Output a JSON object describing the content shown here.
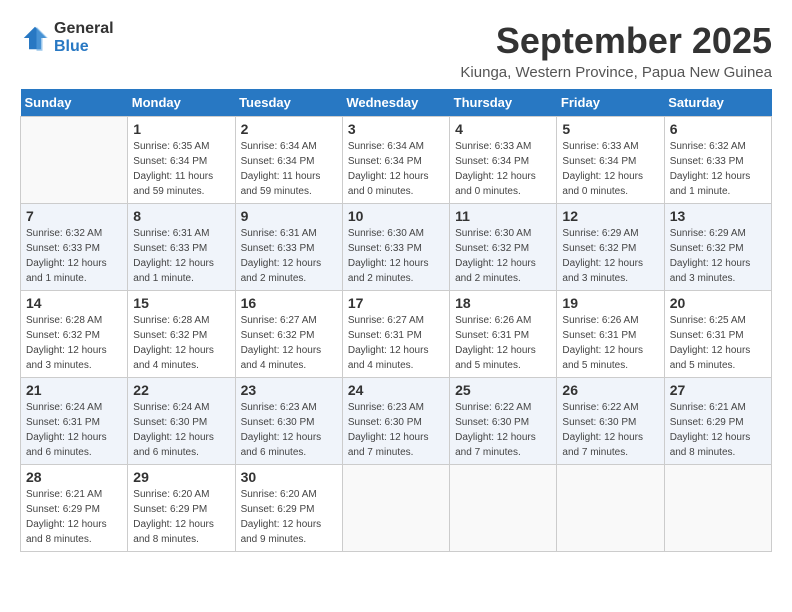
{
  "header": {
    "logo_line1": "General",
    "logo_line2": "Blue",
    "month_title": "September 2025",
    "location": "Kiunga, Western Province, Papua New Guinea"
  },
  "weekdays": [
    "Sunday",
    "Monday",
    "Tuesday",
    "Wednesday",
    "Thursday",
    "Friday",
    "Saturday"
  ],
  "weeks": [
    [
      {
        "day": "",
        "sunrise": "",
        "sunset": "",
        "daylight": ""
      },
      {
        "day": "1",
        "sunrise": "Sunrise: 6:35 AM",
        "sunset": "Sunset: 6:34 PM",
        "daylight": "Daylight: 11 hours and 59 minutes."
      },
      {
        "day": "2",
        "sunrise": "Sunrise: 6:34 AM",
        "sunset": "Sunset: 6:34 PM",
        "daylight": "Daylight: 11 hours and 59 minutes."
      },
      {
        "day": "3",
        "sunrise": "Sunrise: 6:34 AM",
        "sunset": "Sunset: 6:34 PM",
        "daylight": "Daylight: 12 hours and 0 minutes."
      },
      {
        "day": "4",
        "sunrise": "Sunrise: 6:33 AM",
        "sunset": "Sunset: 6:34 PM",
        "daylight": "Daylight: 12 hours and 0 minutes."
      },
      {
        "day": "5",
        "sunrise": "Sunrise: 6:33 AM",
        "sunset": "Sunset: 6:34 PM",
        "daylight": "Daylight: 12 hours and 0 minutes."
      },
      {
        "day": "6",
        "sunrise": "Sunrise: 6:32 AM",
        "sunset": "Sunset: 6:33 PM",
        "daylight": "Daylight: 12 hours and 1 minute."
      }
    ],
    [
      {
        "day": "7",
        "sunrise": "Sunrise: 6:32 AM",
        "sunset": "Sunset: 6:33 PM",
        "daylight": "Daylight: 12 hours and 1 minute."
      },
      {
        "day": "8",
        "sunrise": "Sunrise: 6:31 AM",
        "sunset": "Sunset: 6:33 PM",
        "daylight": "Daylight: 12 hours and 1 minute."
      },
      {
        "day": "9",
        "sunrise": "Sunrise: 6:31 AM",
        "sunset": "Sunset: 6:33 PM",
        "daylight": "Daylight: 12 hours and 2 minutes."
      },
      {
        "day": "10",
        "sunrise": "Sunrise: 6:30 AM",
        "sunset": "Sunset: 6:33 PM",
        "daylight": "Daylight: 12 hours and 2 minutes."
      },
      {
        "day": "11",
        "sunrise": "Sunrise: 6:30 AM",
        "sunset": "Sunset: 6:32 PM",
        "daylight": "Daylight: 12 hours and 2 minutes."
      },
      {
        "day": "12",
        "sunrise": "Sunrise: 6:29 AM",
        "sunset": "Sunset: 6:32 PM",
        "daylight": "Daylight: 12 hours and 3 minutes."
      },
      {
        "day": "13",
        "sunrise": "Sunrise: 6:29 AM",
        "sunset": "Sunset: 6:32 PM",
        "daylight": "Daylight: 12 hours and 3 minutes."
      }
    ],
    [
      {
        "day": "14",
        "sunrise": "Sunrise: 6:28 AM",
        "sunset": "Sunset: 6:32 PM",
        "daylight": "Daylight: 12 hours and 3 minutes."
      },
      {
        "day": "15",
        "sunrise": "Sunrise: 6:28 AM",
        "sunset": "Sunset: 6:32 PM",
        "daylight": "Daylight: 12 hours and 4 minutes."
      },
      {
        "day": "16",
        "sunrise": "Sunrise: 6:27 AM",
        "sunset": "Sunset: 6:32 PM",
        "daylight": "Daylight: 12 hours and 4 minutes."
      },
      {
        "day": "17",
        "sunrise": "Sunrise: 6:27 AM",
        "sunset": "Sunset: 6:31 PM",
        "daylight": "Daylight: 12 hours and 4 minutes."
      },
      {
        "day": "18",
        "sunrise": "Sunrise: 6:26 AM",
        "sunset": "Sunset: 6:31 PM",
        "daylight": "Daylight: 12 hours and 5 minutes."
      },
      {
        "day": "19",
        "sunrise": "Sunrise: 6:26 AM",
        "sunset": "Sunset: 6:31 PM",
        "daylight": "Daylight: 12 hours and 5 minutes."
      },
      {
        "day": "20",
        "sunrise": "Sunrise: 6:25 AM",
        "sunset": "Sunset: 6:31 PM",
        "daylight": "Daylight: 12 hours and 5 minutes."
      }
    ],
    [
      {
        "day": "21",
        "sunrise": "Sunrise: 6:24 AM",
        "sunset": "Sunset: 6:31 PM",
        "daylight": "Daylight: 12 hours and 6 minutes."
      },
      {
        "day": "22",
        "sunrise": "Sunrise: 6:24 AM",
        "sunset": "Sunset: 6:30 PM",
        "daylight": "Daylight: 12 hours and 6 minutes."
      },
      {
        "day": "23",
        "sunrise": "Sunrise: 6:23 AM",
        "sunset": "Sunset: 6:30 PM",
        "daylight": "Daylight: 12 hours and 6 minutes."
      },
      {
        "day": "24",
        "sunrise": "Sunrise: 6:23 AM",
        "sunset": "Sunset: 6:30 PM",
        "daylight": "Daylight: 12 hours and 7 minutes."
      },
      {
        "day": "25",
        "sunrise": "Sunrise: 6:22 AM",
        "sunset": "Sunset: 6:30 PM",
        "daylight": "Daylight: 12 hours and 7 minutes."
      },
      {
        "day": "26",
        "sunrise": "Sunrise: 6:22 AM",
        "sunset": "Sunset: 6:30 PM",
        "daylight": "Daylight: 12 hours and 7 minutes."
      },
      {
        "day": "27",
        "sunrise": "Sunrise: 6:21 AM",
        "sunset": "Sunset: 6:29 PM",
        "daylight": "Daylight: 12 hours and 8 minutes."
      }
    ],
    [
      {
        "day": "28",
        "sunrise": "Sunrise: 6:21 AM",
        "sunset": "Sunset: 6:29 PM",
        "daylight": "Daylight: 12 hours and 8 minutes."
      },
      {
        "day": "29",
        "sunrise": "Sunrise: 6:20 AM",
        "sunset": "Sunset: 6:29 PM",
        "daylight": "Daylight: 12 hours and 8 minutes."
      },
      {
        "day": "30",
        "sunrise": "Sunrise: 6:20 AM",
        "sunset": "Sunset: 6:29 PM",
        "daylight": "Daylight: 12 hours and 9 minutes."
      },
      {
        "day": "",
        "sunrise": "",
        "sunset": "",
        "daylight": ""
      },
      {
        "day": "",
        "sunrise": "",
        "sunset": "",
        "daylight": ""
      },
      {
        "day": "",
        "sunrise": "",
        "sunset": "",
        "daylight": ""
      },
      {
        "day": "",
        "sunrise": "",
        "sunset": "",
        "daylight": ""
      }
    ]
  ]
}
